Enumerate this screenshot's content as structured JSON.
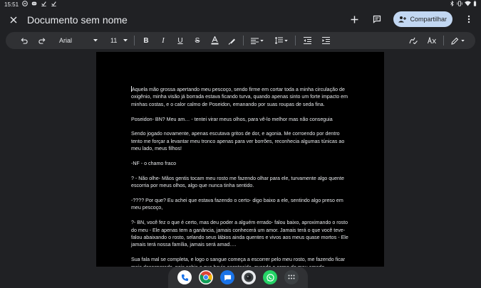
{
  "status": {
    "time": "15:51",
    "left_icons": [
      "messenger-icon",
      "discord-icon",
      "check-icon",
      "check-icon"
    ],
    "right_icons": [
      "bluetooth-icon",
      "vibrate-icon",
      "wifi-icon",
      "battery-icon"
    ]
  },
  "header": {
    "close_icon": "close-icon",
    "title": "Documento sem nome",
    "share_label": "Compartilhar"
  },
  "toolbar": {
    "font": "Arial",
    "size": "11"
  },
  "document": {
    "paragraphs": [
      "Aquela mão grossa apertando meu pescoço, sendo firme em cortar toda a minha circulação de oxigênio, minha visão já borrada estava ficando turva, quando apenas sinto um forte impacto em minhas costas, e o calor calmo de Poseidon, emanando por suas roupas de seda fina.",
      "Poseidon- BN? Meu am… - tentei virar meus olhos, para vê-lo melhor mas não conseguia",
      "Sendo jogado novamente, apenas escutava gritos de dor, e agonia. Me corroendo por dentro tento me forçar a levantar meu tronco apenas para ver borrões, reconhecia algumas túnicas ao meu lado, meus filhos!",
      "-NF - o chamo fraco",
      "? - Não olhe- Mãos gentis tocam meu rosto me fazendo olhar para ele, turvamente algo quente escorria por meus olhos, algo que nunca tinha sentido.",
      "-???? Por que? Eu achei que estava fazendo o certo- digo baixo a ele, sentindo algo preso em meu pescoço,",
      "?- BN, você fez o que é certo, mas deu poder a alguém errado- falou baixo, aproximando o rosto do meu - Ele apenas tem a ganância, jamais conhecerá um amor. Jamais terá o que você teve- falou abaixando o rosto, selando seus lábios ainda quentes e vivos aos meus quase mortos - Ele jamais terá nossa família, jamais será amad….",
      "Sua fala mal se completa, e logo o sangue começa a escorrer pelo meu rosto, me fazendo ficar mais desesperado, pois sabia o que havia acontecido, quando o corpo de meu amado"
    ]
  },
  "dock": {
    "apps": [
      "phone-icon",
      "chrome-icon",
      "messages-icon",
      "camera-icon",
      "whatsapp-icon",
      "app-drawer-icon"
    ]
  },
  "colors": {
    "background": "#202124",
    "toolbar": "#303134",
    "page": "#000000",
    "share": "#c2d7f2"
  }
}
